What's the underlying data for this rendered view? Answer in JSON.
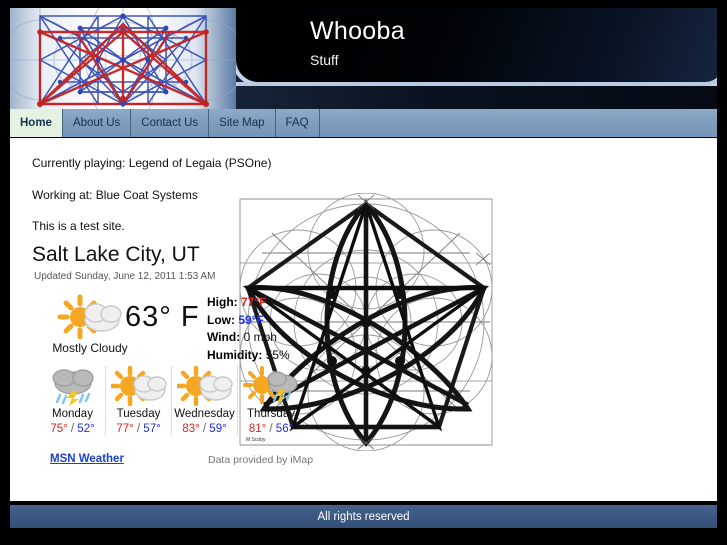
{
  "header": {
    "title": "Whooba",
    "subtitle": "Stuff",
    "logo_icon": "geometric-network-graphic"
  },
  "nav": {
    "items": [
      {
        "label": "Home",
        "active": true
      },
      {
        "label": "About Us",
        "active": false
      },
      {
        "label": "Contact Us",
        "active": false
      },
      {
        "label": "Site Map",
        "active": false
      },
      {
        "label": "FAQ",
        "active": false
      }
    ]
  },
  "content": {
    "line_currently_playing": "Currently playing: Legend of Legaia  (PSOne)",
    "line_working_at": "Working at: Blue Coat Systems",
    "line_test_site": "This is a test site.",
    "weather": {
      "city": "Salt Lake City, UT",
      "updated": "Updated Sunday, June 12, 2011 1:53 AM",
      "current_temp": "63° F",
      "condition": "Mostly Cloudy",
      "condition_icon": "sun-behind-cloud-icon",
      "stats": [
        {
          "key": "High:",
          "value": "77°F",
          "style": "high"
        },
        {
          "key": "Low:",
          "value": "59°F",
          "style": "low"
        },
        {
          "key": "Wind:",
          "value": "0 mph",
          "style": "plain"
        },
        {
          "key": "Humidity:",
          "value": "55%",
          "style": "plain"
        }
      ],
      "forecast": [
        {
          "day": "Monday",
          "icon": "thunderstorm-rain-icon",
          "high": "75°",
          "low": "52°"
        },
        {
          "day": "Tuesday",
          "icon": "sun-behind-cloud-icon",
          "high": "77°",
          "low": "57°"
        },
        {
          "day": "Wednesday",
          "icon": "sun-behind-cloud-icon",
          "high": "83°",
          "low": "59°"
        },
        {
          "day": "Thursday",
          "icon": "sun-cloud-rain-icon",
          "high": "81°",
          "low": "56°"
        }
      ],
      "source_link": "MSN Weather",
      "data_note": "Data provided by iMap"
    },
    "diagram_icon": "geometric-star-construction-diagram"
  },
  "footer": {
    "text": "All rights reserved"
  },
  "colors": {
    "page_border": "#000000",
    "nav_bar": "#7e9cbd",
    "nav_active": "#e3f2e1",
    "footer_bar": "#3b5780",
    "high_temp": "#e02020",
    "low_temp": "#2030e8",
    "link": "#1a3fd6"
  }
}
